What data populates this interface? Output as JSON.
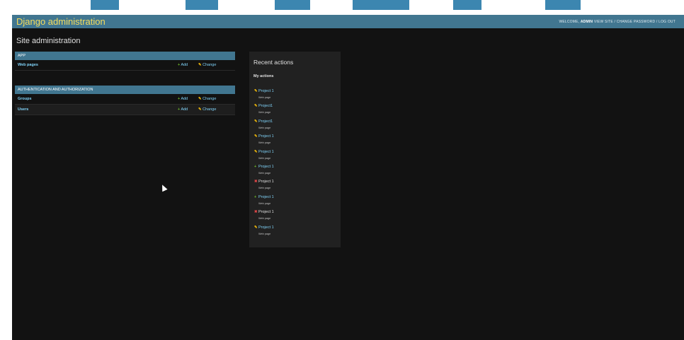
{
  "colors": {
    "header_bg": "#417690",
    "brand": "#f5dd5d",
    "link": "#81d4fa",
    "add_green": "#70bf2b",
    "change_yellow": "#efb80b",
    "delete_red": "#dd4646",
    "body_bg": "#121212"
  },
  "header": {
    "brand": "Django administration",
    "welcome": "WELCOME, ",
    "username": "ADMIN",
    "links": [
      "VIEW SITE",
      "CHANGE PASSWORD",
      "LOG OUT"
    ]
  },
  "page_title": "Site administration",
  "modules": [
    {
      "caption": "APP",
      "models": [
        {
          "name": "Web pages",
          "add": "Add",
          "change": "Change"
        }
      ]
    },
    {
      "caption": "AUTHENTICATION AND AUTHORIZATION",
      "models": [
        {
          "name": "Groups",
          "add": "Add",
          "change": "Change"
        },
        {
          "name": "Users",
          "add": "Add",
          "change": "Change"
        }
      ]
    }
  ],
  "recent_actions": {
    "title": "Recent actions",
    "subtitle": "My actions",
    "items": [
      {
        "type": "change",
        "icon": "pencil-icon",
        "title": "Project 1",
        "sub": "Web page"
      },
      {
        "type": "change",
        "icon": "pencil-icon",
        "title": "Project1",
        "sub": "Web page"
      },
      {
        "type": "change",
        "icon": "pencil-icon",
        "title": "Project1",
        "sub": "Web page"
      },
      {
        "type": "change",
        "icon": "pencil-icon",
        "title": "Project 1",
        "sub": "Web page"
      },
      {
        "type": "change",
        "icon": "pencil-icon",
        "title": "Project 1",
        "sub": "Web page"
      },
      {
        "type": "add",
        "icon": "plus-icon",
        "title": "Project 1",
        "sub": "Web page"
      },
      {
        "type": "delete",
        "icon": "delete-icon",
        "title": "Project 1",
        "sub": "Web page"
      },
      {
        "type": "add",
        "icon": "plus-icon",
        "title": "Project 1",
        "sub": "Web page"
      },
      {
        "type": "delete",
        "icon": "delete-icon",
        "title": "Project 1",
        "sub": "Web page"
      },
      {
        "type": "change",
        "icon": "pencil-icon",
        "title": "Project 1",
        "sub": "Web page"
      }
    ]
  }
}
